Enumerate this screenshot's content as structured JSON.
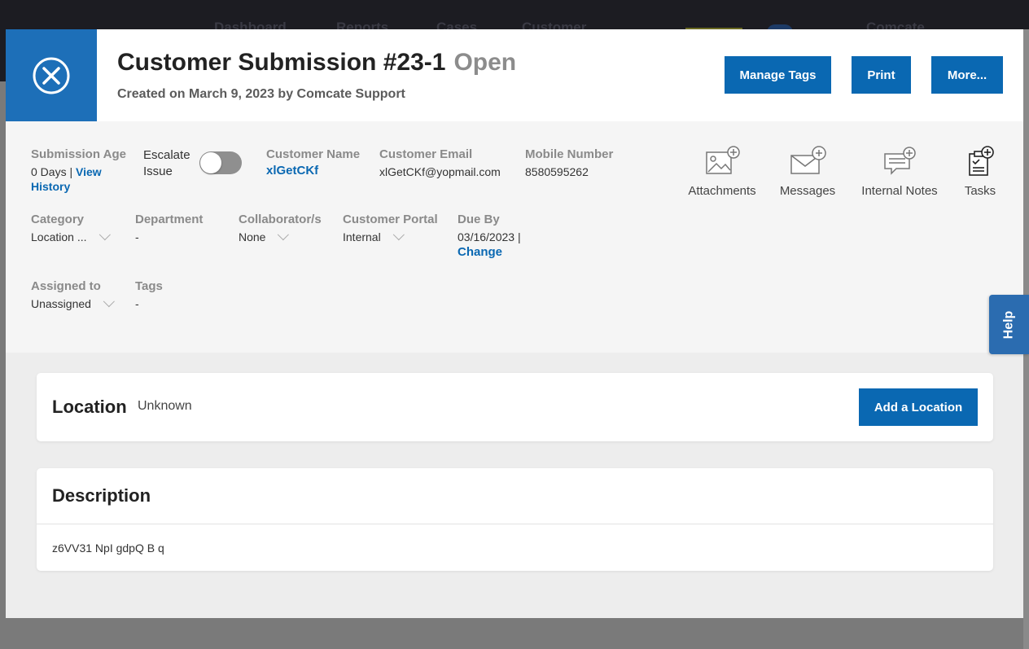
{
  "colors": {
    "primary": "#0a68b2",
    "close_box": "#1d6fb8",
    "status_text": "#8c8c8c",
    "help_tab": "#2b6cb0"
  },
  "background": {
    "nav_items": [
      "Dashboard",
      "Reports",
      "Cases",
      "Customer"
    ],
    "brand": "Comcate"
  },
  "modal": {
    "close_icon": "close-circle-icon",
    "title": "Customer Submission #23-1",
    "status": "Open",
    "subtitle": "Created on March 9, 2023 by Comcate Support",
    "buttons": {
      "manage_tags": "Manage Tags",
      "print": "Print",
      "more": "More..."
    }
  },
  "info": {
    "submission_age": {
      "label": "Submission Age",
      "value": "0 Days |",
      "link": "View History"
    },
    "escalate": {
      "label_line1": "Escalate",
      "label_line2": "Issue",
      "on": false
    },
    "customer_name": {
      "label": "Customer Name",
      "value": "xlGetCKf"
    },
    "customer_email": {
      "label": "Customer Email",
      "value": "xlGetCKf@yopmail.com"
    },
    "mobile_number": {
      "label": "Mobile Number",
      "value": "8580595262"
    },
    "category": {
      "label": "Category",
      "value": "Location ..."
    },
    "department": {
      "label": "Department",
      "value": "-"
    },
    "collaborators": {
      "label": "Collaborator/s",
      "value": "None"
    },
    "customer_portal": {
      "label": "Customer Portal",
      "value": "Internal"
    },
    "due_by": {
      "label": "Due By",
      "value": "03/16/2023 |",
      "link": "Change"
    },
    "assigned_to": {
      "label": "Assigned to",
      "value": "Unassigned"
    },
    "tags": {
      "label": "Tags",
      "value": "-"
    }
  },
  "actions": [
    {
      "label": "Attachments",
      "icon": "attachment-add-icon"
    },
    {
      "label": "Messages",
      "icon": "message-add-icon"
    },
    {
      "label": "Internal Notes",
      "icon": "note-add-icon"
    },
    {
      "label": "Tasks",
      "icon": "task-add-icon"
    }
  ],
  "location": {
    "title": "Location",
    "value": "Unknown",
    "button": "Add a Location"
  },
  "description": {
    "title": "Description",
    "text": "z6VV31 NpI gdpQ B q"
  },
  "help": {
    "label": "Help"
  }
}
